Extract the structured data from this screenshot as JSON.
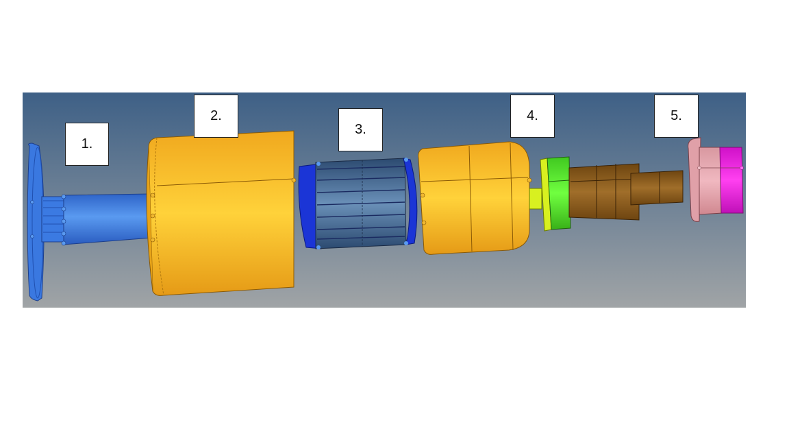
{
  "labels": {
    "part1": "1.",
    "part2": "2.",
    "part3": "3.",
    "part4": "4.",
    "part5": "5."
  },
  "colors": {
    "background_top": "#3e6086",
    "background_bottom": "#a0a4a6",
    "shaft_blue": "#3a78e0",
    "housing_yellow": "#f6b42a",
    "rotor_blue": "#4a6d94",
    "rotor_end_blue": "#1b35d6",
    "bearing_green": "#58ee2a",
    "shaft_brown": "#8a5a1a",
    "cap_pink": "#e8a8b0",
    "cap_magenta": "#f020e0"
  }
}
